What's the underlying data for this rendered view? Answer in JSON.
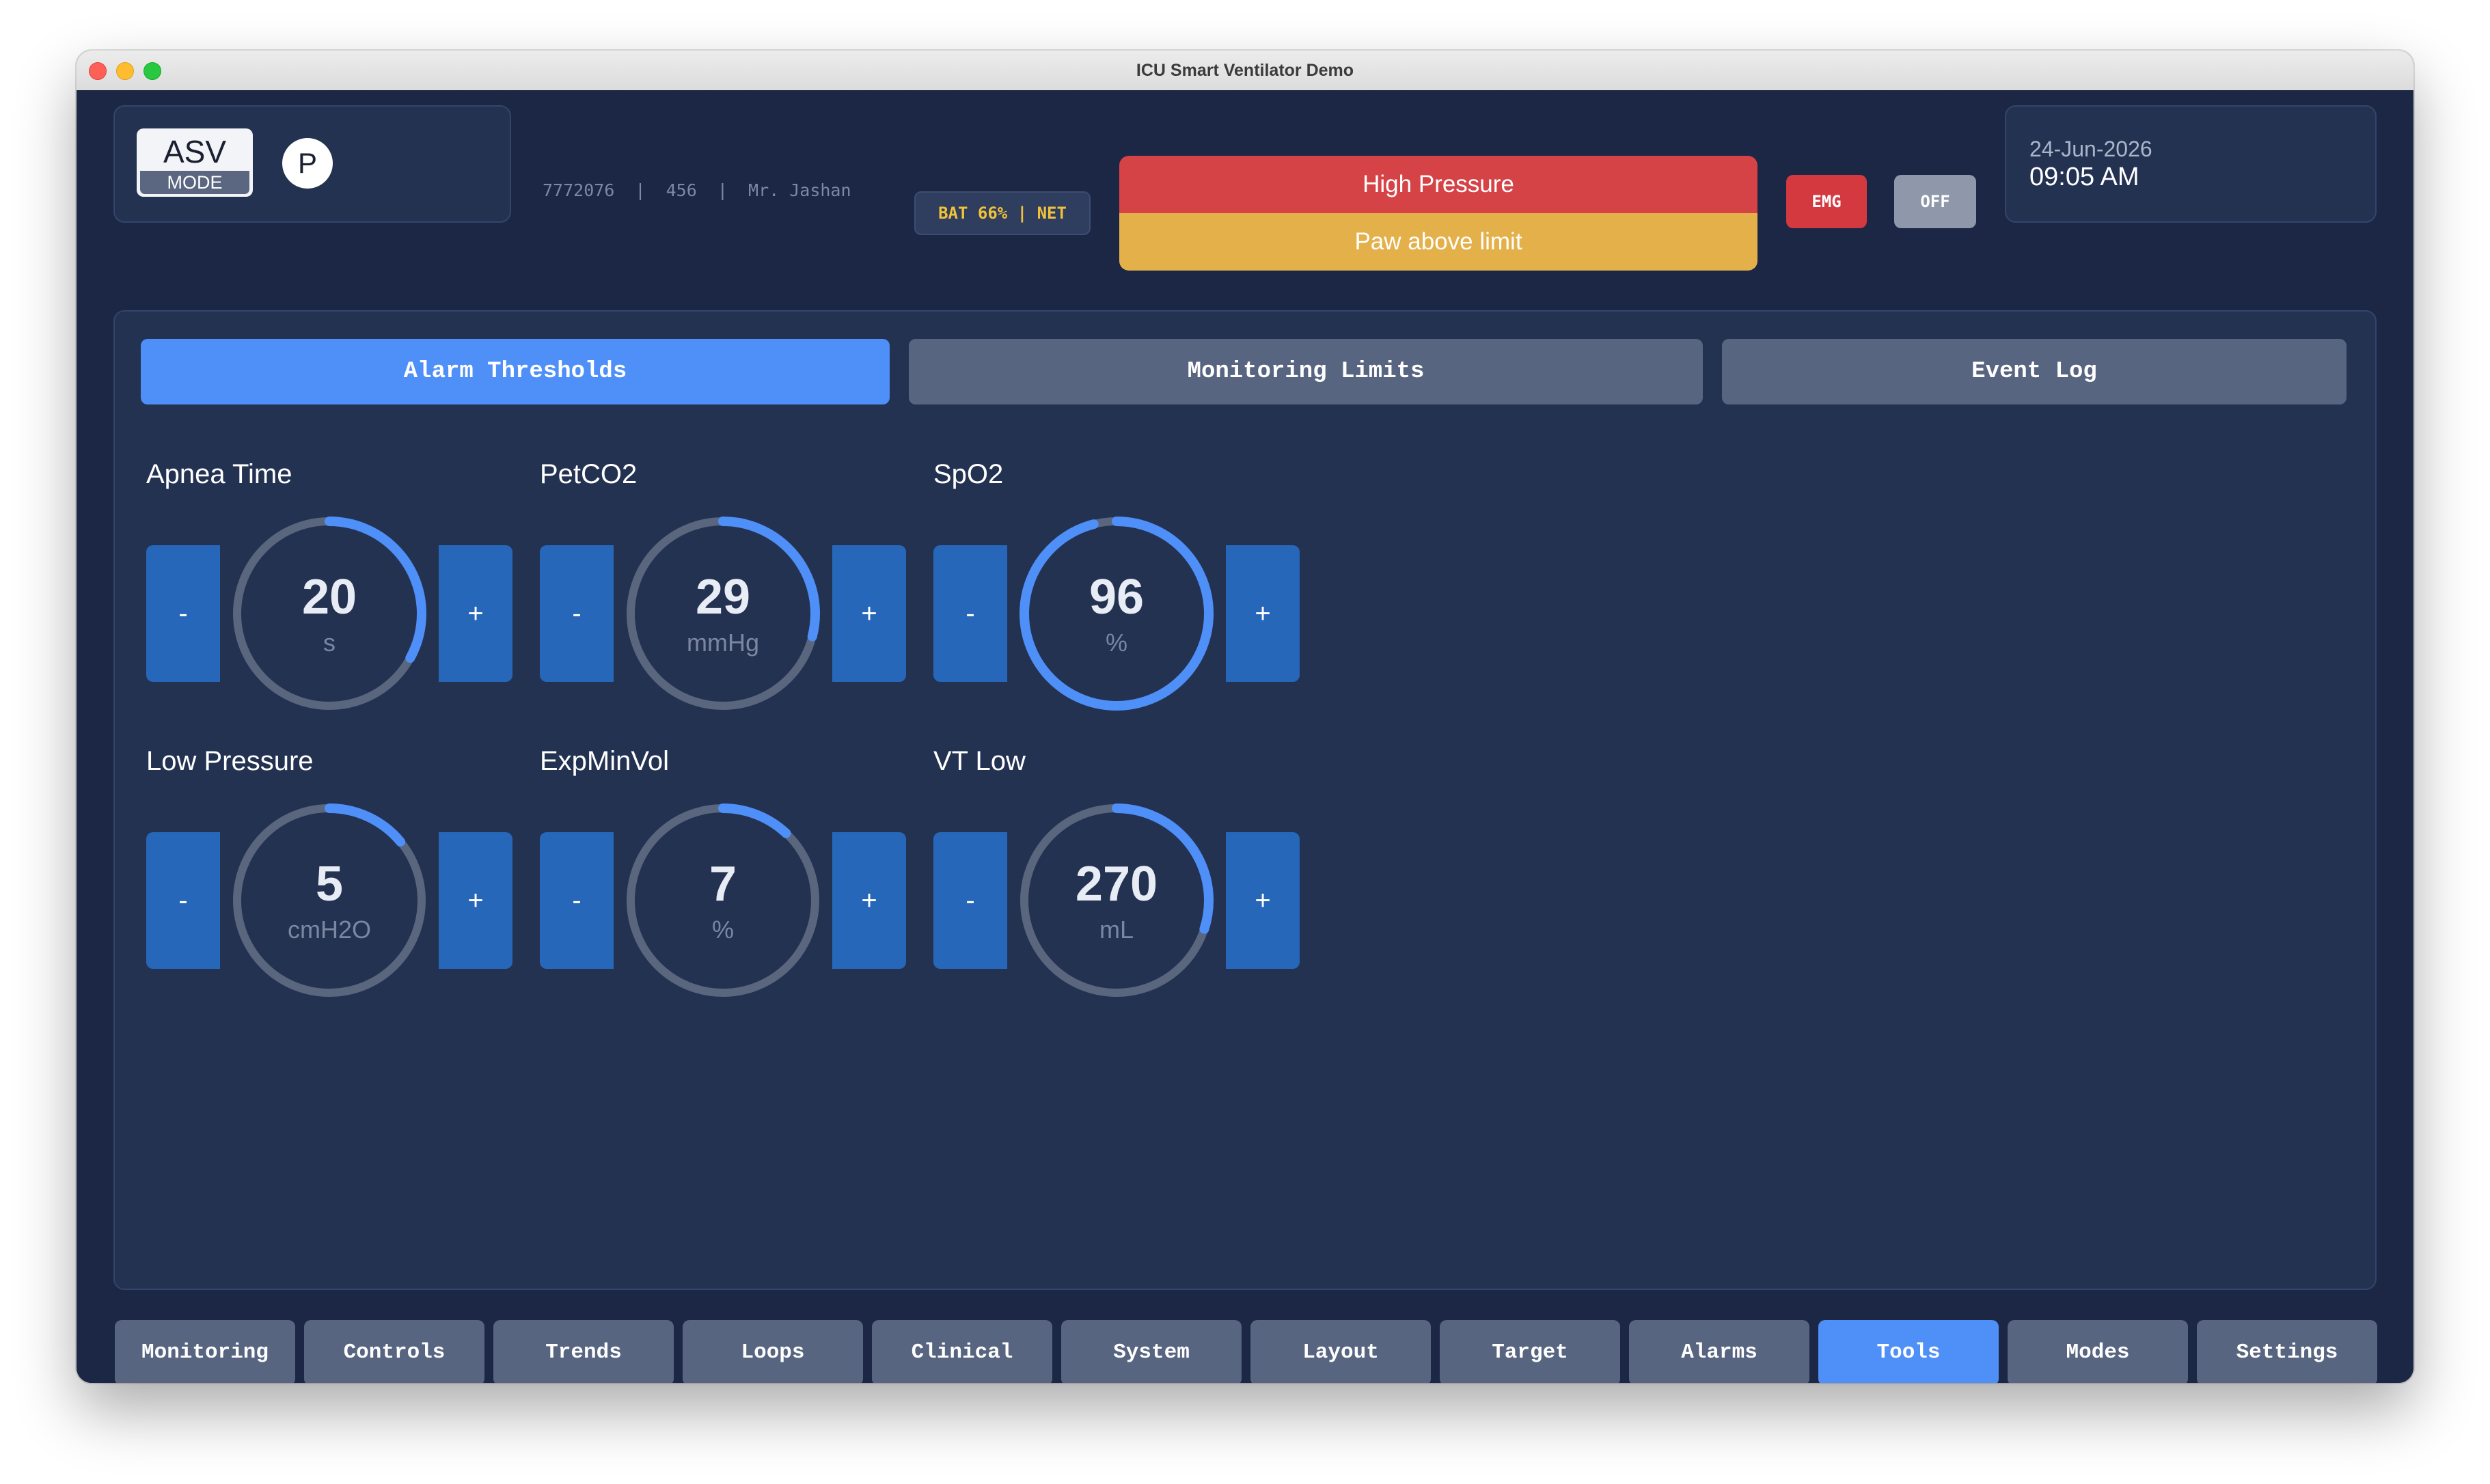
{
  "window": {
    "title": "ICU Smart Ventilator Demo"
  },
  "header": {
    "mode": {
      "value": "ASV",
      "label": "MODE"
    },
    "profile_letter": "P",
    "patient_info": "7772076  |  456  |  Mr. Jashan",
    "status": "BAT 66% | NET",
    "alarm": {
      "primary": "High Pressure",
      "secondary": "Paw above limit"
    },
    "emg_label": "EMG",
    "off_label": "OFF",
    "date": "24-Jun-2026",
    "time": "09:05 AM"
  },
  "tabs": [
    {
      "label": "Alarm Thresholds",
      "active": true
    },
    {
      "label": "Monitoring Limits",
      "active": false
    },
    {
      "label": "Event Log",
      "active": false
    }
  ],
  "dials": [
    {
      "label": "Apnea Time",
      "value": "20",
      "unit": "s",
      "fill": 0.33
    },
    {
      "label": "PetCO2",
      "value": "29",
      "unit": "mmHg",
      "fill": 0.29
    },
    {
      "label": "SpO2",
      "value": "96",
      "unit": "%",
      "fill": 0.96
    },
    {
      "label": "Low Pressure",
      "value": "5",
      "unit": "cmH2O",
      "fill": 0.14
    },
    {
      "label": "ExpMinVol",
      "value": "7",
      "unit": "%",
      "fill": 0.12
    },
    {
      "label": "VT Low",
      "value": "270",
      "unit": "mL",
      "fill": 0.3
    }
  ],
  "dial_controls": {
    "minus": "-",
    "plus": "+"
  },
  "bottom_nav": [
    {
      "label": "Monitoring",
      "active": false
    },
    {
      "label": "Controls",
      "active": false
    },
    {
      "label": "Trends",
      "active": false
    },
    {
      "label": "Loops",
      "active": false
    },
    {
      "label": "Clinical",
      "active": false
    },
    {
      "label": "System",
      "active": false
    },
    {
      "label": "Layout",
      "active": false
    },
    {
      "label": "Target",
      "active": false
    },
    {
      "label": "Alarms",
      "active": false
    },
    {
      "label": "Tools",
      "active": true
    },
    {
      "label": "Modes",
      "active": false
    },
    {
      "label": "Settings",
      "active": false
    }
  ],
  "colors": {
    "accent": "#4f8ff8",
    "alarm_red": "#d54347",
    "alarm_yellow": "#e4b04a",
    "dial_track": "#5a657e",
    "background": "#1b2744"
  }
}
